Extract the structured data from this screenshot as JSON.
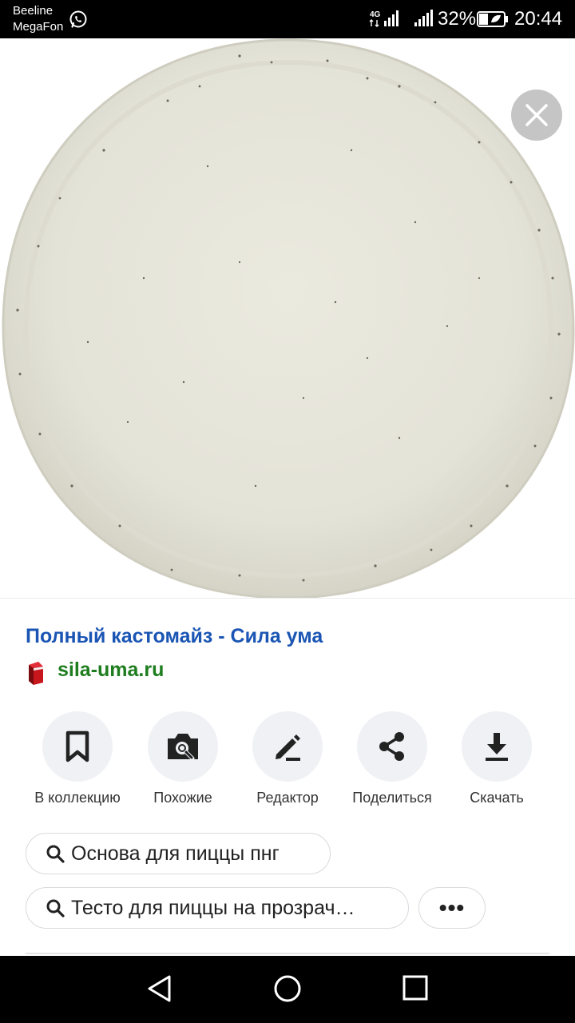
{
  "status_bar": {
    "carrier1": "Beeline",
    "carrier2": "MegaFon",
    "network": "4G",
    "battery": "32%",
    "time": "20:44",
    "icons": [
      "whatsapp-icon",
      "signal-icon",
      "battery-icon"
    ]
  },
  "result": {
    "title": "Полный кастомайз - Сила ума",
    "source": "sila-uma.ru",
    "title_color": "#1a55b4",
    "source_color": "#1e7d1e"
  },
  "actions": [
    {
      "label": "В коллекцию",
      "icon": "bookmark-icon"
    },
    {
      "label": "Похожие",
      "icon": "camera-search-icon"
    },
    {
      "label": "Редактор",
      "icon": "pencil-icon"
    },
    {
      "label": "Поделиться",
      "icon": "share-icon"
    },
    {
      "label": "Скачать",
      "icon": "download-icon"
    }
  ],
  "chips": [
    {
      "text": "Основа для пиццы пнг",
      "icon": "search-icon"
    },
    {
      "text": "Тесто для пиццы на прозрач…",
      "icon": "search-icon"
    }
  ],
  "more_label": "•••",
  "nav": [
    "back-icon",
    "home-icon",
    "recent-apps-icon"
  ]
}
